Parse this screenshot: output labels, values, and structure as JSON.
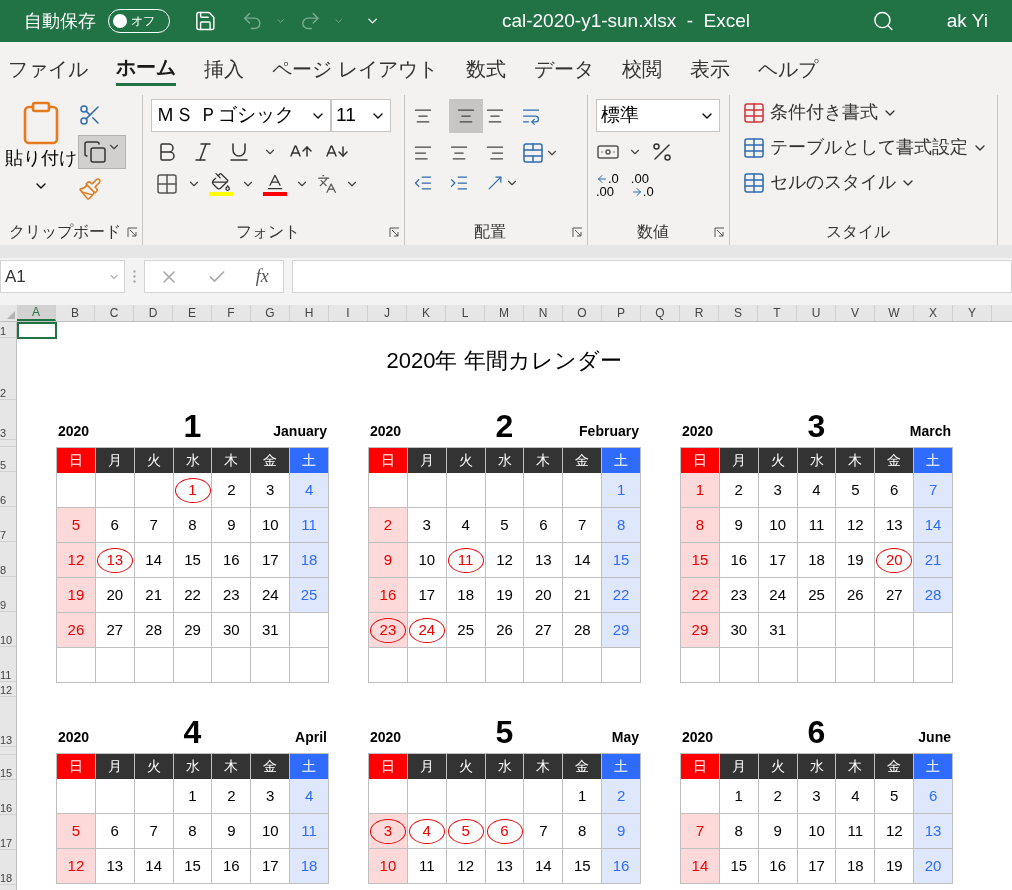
{
  "title_bar": {
    "autosave_label": "自動保存",
    "autosave_toggle": {
      "label": "オフ",
      "on": false
    },
    "title": "cal-2020-y1-sun.xlsx  -  Excel",
    "user": "ak Yi"
  },
  "tabs": [
    {
      "label": "ファイル",
      "selected": false
    },
    {
      "label": "ホーム",
      "selected": true
    },
    {
      "label": "挿入",
      "selected": false
    },
    {
      "label": "ページ レイアウト",
      "selected": false
    },
    {
      "label": "数式",
      "selected": false
    },
    {
      "label": "データ",
      "selected": false
    },
    {
      "label": "校閲",
      "selected": false
    },
    {
      "label": "表示",
      "selected": false
    },
    {
      "label": "ヘルプ",
      "selected": false
    }
  ],
  "ribbon": {
    "clipboard": {
      "paste": "貼り付け",
      "label": "クリップボード"
    },
    "font": {
      "name": "ＭＳ Ｐゴシック",
      "size": "11",
      "label": "フォント"
    },
    "alignment": {
      "label": "配置"
    },
    "number": {
      "format": "標準",
      "decimal_buttons": [
        {
          "top": ".0",
          "bottom": ".00"
        },
        {
          "top": ".00",
          "bottom": ".0"
        }
      ],
      "label": "数値"
    },
    "styles": {
      "buttons": [
        "条件付き書式",
        "テーブルとして書式設定",
        "セルのスタイル"
      ],
      "label": "スタイル"
    }
  },
  "formula_bar": {
    "name_box": "A1",
    "fx": "fx"
  },
  "columns": [
    "A",
    "B",
    "C",
    "D",
    "E",
    "F",
    "G",
    "H",
    "I",
    "J",
    "K",
    "L",
    "M",
    "N",
    "O",
    "P",
    "Q",
    "R",
    "S",
    "T",
    "U",
    "V",
    "W",
    "X",
    "Y"
  ],
  "row_headers": [
    "1",
    "2",
    "3",
    "5",
    "6",
    "7",
    "8",
    "9",
    "10",
    "11",
    "12",
    "13",
    "15",
    "16",
    "17",
    "18"
  ],
  "sheet_title": "2020年 年間カレンダー",
  "months": [
    {
      "year": "2020",
      "number": "1",
      "name": "January",
      "weekdays": [
        "日",
        "月",
        "火",
        "水",
        "木",
        "金",
        "土"
      ],
      "weeks": [
        [
          {
            "kind": "blank"
          },
          {
            "kind": "blank"
          },
          {
            "kind": "blank"
          },
          {
            "kind": "day",
            "day": "1",
            "holiday": true
          },
          {
            "kind": "day",
            "day": "2",
            "holiday": false
          },
          {
            "kind": "day",
            "day": "3",
            "holiday": false
          },
          {
            "kind": "day",
            "day": "4",
            "holiday": false
          }
        ],
        [
          {
            "kind": "day",
            "day": "5",
            "holiday": false
          },
          {
            "kind": "day",
            "day": "6",
            "holiday": false
          },
          {
            "kind": "day",
            "day": "7",
            "holiday": false
          },
          {
            "kind": "day",
            "day": "8",
            "holiday": false
          },
          {
            "kind": "day",
            "day": "9",
            "holiday": false
          },
          {
            "kind": "day",
            "day": "10",
            "holiday": false
          },
          {
            "kind": "day",
            "day": "11",
            "holiday": false
          }
        ],
        [
          {
            "kind": "day",
            "day": "12",
            "holiday": false
          },
          {
            "kind": "day",
            "day": "13",
            "holiday": true
          },
          {
            "kind": "day",
            "day": "14",
            "holiday": false
          },
          {
            "kind": "day",
            "day": "15",
            "holiday": false
          },
          {
            "kind": "day",
            "day": "16",
            "holiday": false
          },
          {
            "kind": "day",
            "day": "17",
            "holiday": false
          },
          {
            "kind": "day",
            "day": "18",
            "holiday": false
          }
        ],
        [
          {
            "kind": "day",
            "day": "19",
            "holiday": false
          },
          {
            "kind": "day",
            "day": "20",
            "holiday": false
          },
          {
            "kind": "day",
            "day": "21",
            "holiday": false
          },
          {
            "kind": "day",
            "day": "22",
            "holiday": false
          },
          {
            "kind": "day",
            "day": "23",
            "holiday": false
          },
          {
            "kind": "day",
            "day": "24",
            "holiday": false
          },
          {
            "kind": "day",
            "day": "25",
            "holiday": false
          }
        ],
        [
          {
            "kind": "day",
            "day": "26",
            "holiday": false
          },
          {
            "kind": "day",
            "day": "27",
            "holiday": false
          },
          {
            "kind": "day",
            "day": "28",
            "holiday": false
          },
          {
            "kind": "day",
            "day": "29",
            "holiday": false
          },
          {
            "kind": "day",
            "day": "30",
            "holiday": false
          },
          {
            "kind": "day",
            "day": "31",
            "holiday": false
          },
          {
            "kind": "blank"
          }
        ],
        [
          {
            "kind": "blank"
          },
          {
            "kind": "blank"
          },
          {
            "kind": "blank"
          },
          {
            "kind": "blank"
          },
          {
            "kind": "blank"
          },
          {
            "kind": "blank"
          },
          {
            "kind": "blank"
          }
        ]
      ]
    },
    {
      "year": "2020",
      "number": "2",
      "name": "February",
      "weekdays": [
        "日",
        "月",
        "火",
        "水",
        "木",
        "金",
        "土"
      ],
      "weeks": [
        [
          {
            "kind": "blank"
          },
          {
            "kind": "blank"
          },
          {
            "kind": "blank"
          },
          {
            "kind": "blank"
          },
          {
            "kind": "blank"
          },
          {
            "kind": "blank"
          },
          {
            "kind": "day",
            "day": "1",
            "holiday": false
          }
        ],
        [
          {
            "kind": "day",
            "day": "2",
            "holiday": false
          },
          {
            "kind": "day",
            "day": "3",
            "holiday": false
          },
          {
            "kind": "day",
            "day": "4",
            "holiday": false
          },
          {
            "kind": "day",
            "day": "5",
            "holiday": false
          },
          {
            "kind": "day",
            "day": "6",
            "holiday": false
          },
          {
            "kind": "day",
            "day": "7",
            "holiday": false
          },
          {
            "kind": "day",
            "day": "8",
            "holiday": false
          }
        ],
        [
          {
            "kind": "day",
            "day": "9",
            "holiday": false
          },
          {
            "kind": "day",
            "day": "10",
            "holiday": false
          },
          {
            "kind": "day",
            "day": "11",
            "holiday": true
          },
          {
            "kind": "day",
            "day": "12",
            "holiday": false
          },
          {
            "kind": "day",
            "day": "13",
            "holiday": false
          },
          {
            "kind": "day",
            "day": "14",
            "holiday": false
          },
          {
            "kind": "day",
            "day": "15",
            "holiday": false
          }
        ],
        [
          {
            "kind": "day",
            "day": "16",
            "holiday": false
          },
          {
            "kind": "day",
            "day": "17",
            "holiday": false
          },
          {
            "kind": "day",
            "day": "18",
            "holiday": false
          },
          {
            "kind": "day",
            "day": "19",
            "holiday": false
          },
          {
            "kind": "day",
            "day": "20",
            "holiday": false
          },
          {
            "kind": "day",
            "day": "21",
            "holiday": false
          },
          {
            "kind": "day",
            "day": "22",
            "holiday": false
          }
        ],
        [
          {
            "kind": "day",
            "day": "23",
            "holiday": true
          },
          {
            "kind": "day",
            "day": "24",
            "holiday": true
          },
          {
            "kind": "day",
            "day": "25",
            "holiday": false
          },
          {
            "kind": "day",
            "day": "26",
            "holiday": false
          },
          {
            "kind": "day",
            "day": "27",
            "holiday": false
          },
          {
            "kind": "day",
            "day": "28",
            "holiday": false
          },
          {
            "kind": "day",
            "day": "29",
            "holiday": false
          }
        ],
        [
          {
            "kind": "blank"
          },
          {
            "kind": "blank"
          },
          {
            "kind": "blank"
          },
          {
            "kind": "blank"
          },
          {
            "kind": "blank"
          },
          {
            "kind": "blank"
          },
          {
            "kind": "blank"
          }
        ]
      ]
    },
    {
      "year": "2020",
      "number": "3",
      "name": "March",
      "weekdays": [
        "日",
        "月",
        "火",
        "水",
        "木",
        "金",
        "土"
      ],
      "weeks": [
        [
          {
            "kind": "day",
            "day": "1",
            "holiday": false
          },
          {
            "kind": "day",
            "day": "2",
            "holiday": false
          },
          {
            "kind": "day",
            "day": "3",
            "holiday": false
          },
          {
            "kind": "day",
            "day": "4",
            "holiday": false
          },
          {
            "kind": "day",
            "day": "5",
            "holiday": false
          },
          {
            "kind": "day",
            "day": "6",
            "holiday": false
          },
          {
            "kind": "day",
            "day": "7",
            "holiday": false
          }
        ],
        [
          {
            "kind": "day",
            "day": "8",
            "holiday": false
          },
          {
            "kind": "day",
            "day": "9",
            "holiday": false
          },
          {
            "kind": "day",
            "day": "10",
            "holiday": false
          },
          {
            "kind": "day",
            "day": "11",
            "holiday": false
          },
          {
            "kind": "day",
            "day": "12",
            "holiday": false
          },
          {
            "kind": "day",
            "day": "13",
            "holiday": false
          },
          {
            "kind": "day",
            "day": "14",
            "holiday": false
          }
        ],
        [
          {
            "kind": "day",
            "day": "15",
            "holiday": false
          },
          {
            "kind": "day",
            "day": "16",
            "holiday": false
          },
          {
            "kind": "day",
            "day": "17",
            "holiday": false
          },
          {
            "kind": "day",
            "day": "18",
            "holiday": false
          },
          {
            "kind": "day",
            "day": "19",
            "holiday": false
          },
          {
            "kind": "day",
            "day": "20",
            "holiday": true
          },
          {
            "kind": "day",
            "day": "21",
            "holiday": false
          }
        ],
        [
          {
            "kind": "day",
            "day": "22",
            "holiday": false
          },
          {
            "kind": "day",
            "day": "23",
            "holiday": false
          },
          {
            "kind": "day",
            "day": "24",
            "holiday": false
          },
          {
            "kind": "day",
            "day": "25",
            "holiday": false
          },
          {
            "kind": "day",
            "day": "26",
            "holiday": false
          },
          {
            "kind": "day",
            "day": "27",
            "holiday": false
          },
          {
            "kind": "day",
            "day": "28",
            "holiday": false
          }
        ],
        [
          {
            "kind": "day",
            "day": "29",
            "holiday": false
          },
          {
            "kind": "day",
            "day": "30",
            "holiday": false
          },
          {
            "kind": "day",
            "day": "31",
            "holiday": false
          },
          {
            "kind": "blank"
          },
          {
            "kind": "blank"
          },
          {
            "kind": "blank"
          },
          {
            "kind": "blank"
          }
        ],
        [
          {
            "kind": "blank"
          },
          {
            "kind": "blank"
          },
          {
            "kind": "blank"
          },
          {
            "kind": "blank"
          },
          {
            "kind": "blank"
          },
          {
            "kind": "blank"
          },
          {
            "kind": "blank"
          }
        ]
      ]
    },
    {
      "year": "2020",
      "number": "4",
      "name": "April",
      "weekdays": [
        "日",
        "月",
        "火",
        "水",
        "木",
        "金",
        "土"
      ],
      "weeks": [
        [
          {
            "kind": "blank"
          },
          {
            "kind": "blank"
          },
          {
            "kind": "blank"
          },
          {
            "kind": "day",
            "day": "1",
            "holiday": false
          },
          {
            "kind": "day",
            "day": "2",
            "holiday": false
          },
          {
            "kind": "day",
            "day": "3",
            "holiday": false
          },
          {
            "kind": "day",
            "day": "4",
            "holiday": false
          }
        ],
        [
          {
            "kind": "day",
            "day": "5",
            "holiday": false
          },
          {
            "kind": "day",
            "day": "6",
            "holiday": false
          },
          {
            "kind": "day",
            "day": "7",
            "holiday": false
          },
          {
            "kind": "day",
            "day": "8",
            "holiday": false
          },
          {
            "kind": "day",
            "day": "9",
            "holiday": false
          },
          {
            "kind": "day",
            "day": "10",
            "holiday": false
          },
          {
            "kind": "day",
            "day": "11",
            "holiday": false
          }
        ],
        [
          {
            "kind": "day",
            "day": "12",
            "holiday": false
          },
          {
            "kind": "day",
            "day": "13",
            "holiday": false
          },
          {
            "kind": "day",
            "day": "14",
            "holiday": false
          },
          {
            "kind": "day",
            "day": "15",
            "holiday": false
          },
          {
            "kind": "day",
            "day": "16",
            "holiday": false
          },
          {
            "kind": "day",
            "day": "17",
            "holiday": false
          },
          {
            "kind": "day",
            "day": "18",
            "holiday": false
          }
        ]
      ]
    },
    {
      "year": "2020",
      "number": "5",
      "name": "May",
      "weekdays": [
        "日",
        "月",
        "火",
        "水",
        "木",
        "金",
        "土"
      ],
      "weeks": [
        [
          {
            "kind": "blank"
          },
          {
            "kind": "blank"
          },
          {
            "kind": "blank"
          },
          {
            "kind": "blank"
          },
          {
            "kind": "blank"
          },
          {
            "kind": "day",
            "day": "1",
            "holiday": false
          },
          {
            "kind": "day",
            "day": "2",
            "holiday": false
          }
        ],
        [
          {
            "kind": "day",
            "day": "3",
            "holiday": true
          },
          {
            "kind": "day",
            "day": "4",
            "holiday": true
          },
          {
            "kind": "day",
            "day": "5",
            "holiday": true
          },
          {
            "kind": "day",
            "day": "6",
            "holiday": true
          },
          {
            "kind": "day",
            "day": "7",
            "holiday": false
          },
          {
            "kind": "day",
            "day": "8",
            "holiday": false
          },
          {
            "kind": "day",
            "day": "9",
            "holiday": false
          }
        ],
        [
          {
            "kind": "day",
            "day": "10",
            "holiday": false
          },
          {
            "kind": "day",
            "day": "11",
            "holiday": false
          },
          {
            "kind": "day",
            "day": "12",
            "holiday": false
          },
          {
            "kind": "day",
            "day": "13",
            "holiday": false
          },
          {
            "kind": "day",
            "day": "14",
            "holiday": false
          },
          {
            "kind": "day",
            "day": "15",
            "holiday": false
          },
          {
            "kind": "day",
            "day": "16",
            "holiday": false
          }
        ]
      ]
    },
    {
      "year": "2020",
      "number": "6",
      "name": "June",
      "weekdays": [
        "日",
        "月",
        "火",
        "水",
        "木",
        "金",
        "土"
      ],
      "weeks": [
        [
          {
            "kind": "blank"
          },
          {
            "kind": "day",
            "day": "1",
            "holiday": false
          },
          {
            "kind": "day",
            "day": "2",
            "holiday": false
          },
          {
            "kind": "day",
            "day": "3",
            "holiday": false
          },
          {
            "kind": "day",
            "day": "4",
            "holiday": false
          },
          {
            "kind": "day",
            "day": "5",
            "holiday": false
          },
          {
            "kind": "day",
            "day": "6",
            "holiday": false
          }
        ],
        [
          {
            "kind": "day",
            "day": "7",
            "holiday": false
          },
          {
            "kind": "day",
            "day": "8",
            "holiday": false
          },
          {
            "kind": "day",
            "day": "9",
            "holiday": false
          },
          {
            "kind": "day",
            "day": "10",
            "holiday": false
          },
          {
            "kind": "day",
            "day": "11",
            "holiday": false
          },
          {
            "kind": "day",
            "day": "12",
            "holiday": false
          },
          {
            "kind": "day",
            "day": "13",
            "holiday": false
          }
        ],
        [
          {
            "kind": "day",
            "day": "14",
            "holiday": false
          },
          {
            "kind": "day",
            "day": "15",
            "holiday": false
          },
          {
            "kind": "day",
            "day": "16",
            "holiday": false
          },
          {
            "kind": "day",
            "day": "17",
            "holiday": false
          },
          {
            "kind": "day",
            "day": "18",
            "holiday": false
          },
          {
            "kind": "day",
            "day": "19",
            "holiday": false
          },
          {
            "kind": "day",
            "day": "20",
            "holiday": false
          }
        ]
      ]
    }
  ]
}
